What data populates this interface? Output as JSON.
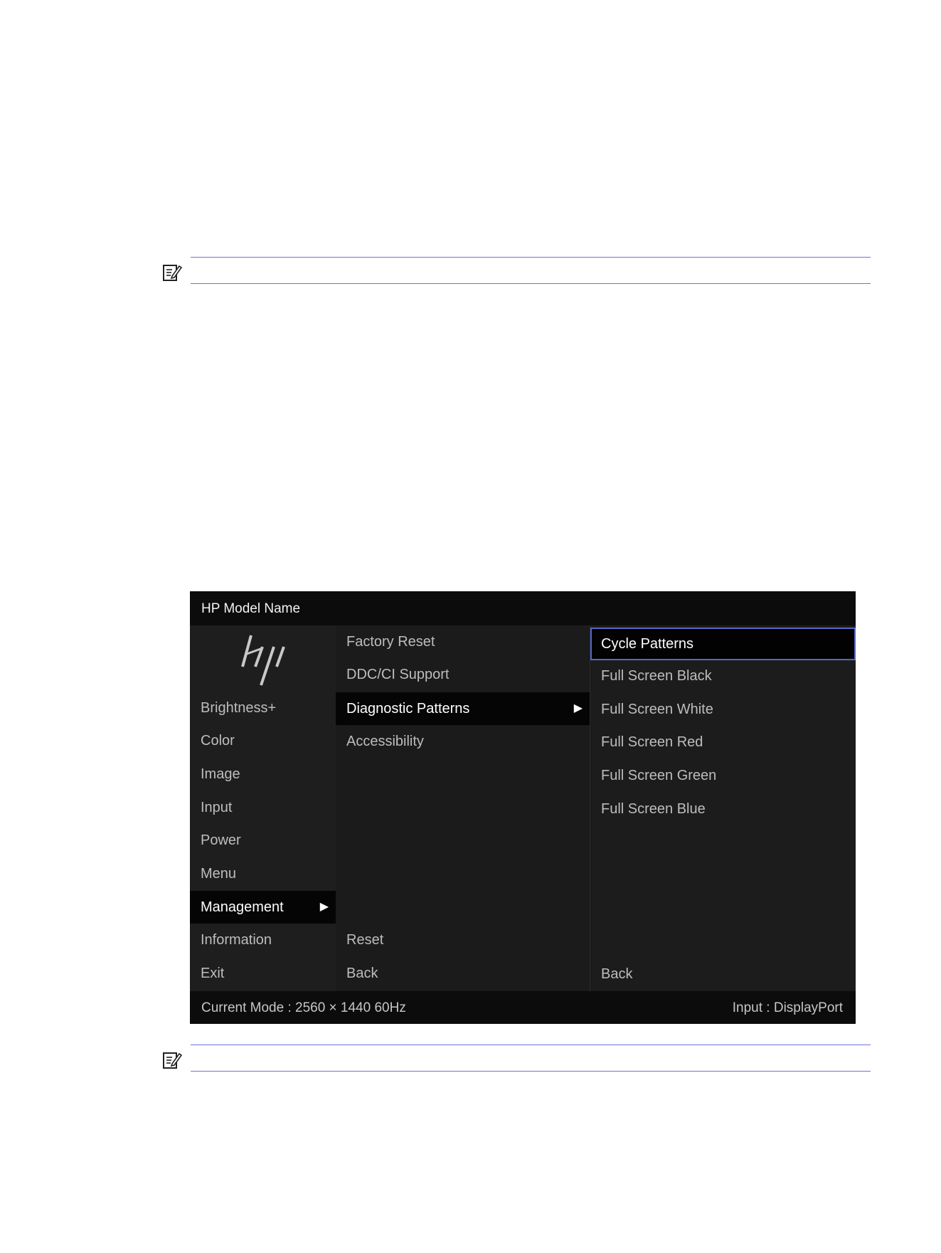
{
  "osd": {
    "title": "HP Model Name",
    "main_menu": [
      {
        "label": "Brightness+",
        "active": false
      },
      {
        "label": "Color",
        "active": false
      },
      {
        "label": "Image",
        "active": false
      },
      {
        "label": "Input",
        "active": false
      },
      {
        "label": "Power",
        "active": false
      },
      {
        "label": "Menu",
        "active": false
      },
      {
        "label": "Management",
        "active": true
      },
      {
        "label": "Information",
        "active": false
      },
      {
        "label": "Exit",
        "active": false
      }
    ],
    "submenu": [
      {
        "label": "Factory Reset"
      },
      {
        "label": "DDC/CI Support"
      },
      {
        "label": "Diagnostic Patterns",
        "active": true
      },
      {
        "label": "Accessibility"
      }
    ],
    "submenu_reset": "Reset",
    "submenu_back": "Back",
    "patterns": [
      {
        "label": "Cycle Patterns",
        "selected": true
      },
      {
        "label": "Full Screen Black"
      },
      {
        "label": "Full Screen White"
      },
      {
        "label": "Full Screen Red"
      },
      {
        "label": "Full Screen Green"
      },
      {
        "label": "Full Screen Blue"
      }
    ],
    "patterns_back": "Back",
    "footer_mode": "Current Mode : 2560 × 1440   60Hz",
    "footer_input": "Input : DisplayPort",
    "arrow_icon": "▶"
  },
  "colors": {
    "note_rule": "#6f73d2",
    "selection_border": "#5566c8",
    "osd_background": "#1d1d1d"
  }
}
